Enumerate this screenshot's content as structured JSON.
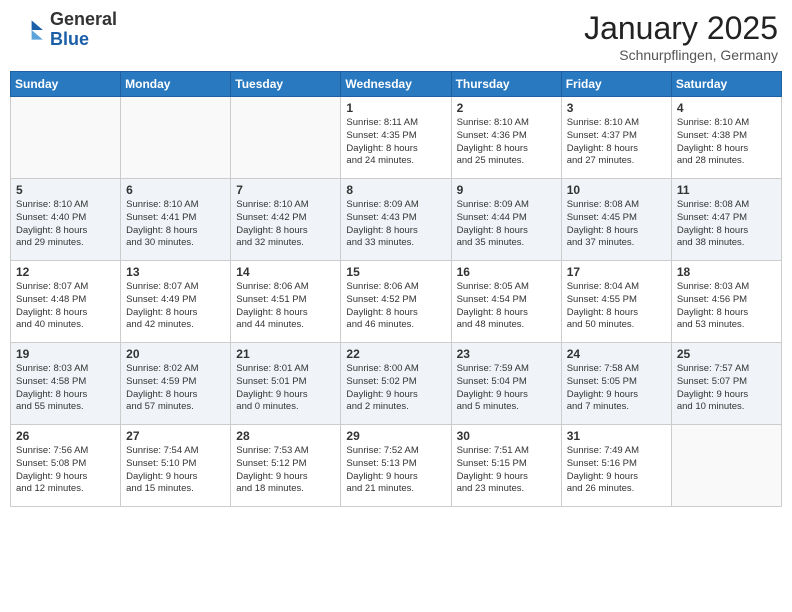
{
  "header": {
    "logo_general": "General",
    "logo_blue": "Blue",
    "month": "January 2025",
    "location": "Schnurpflingen, Germany"
  },
  "weekdays": [
    "Sunday",
    "Monday",
    "Tuesday",
    "Wednesday",
    "Thursday",
    "Friday",
    "Saturday"
  ],
  "weeks": [
    [
      {
        "day": "",
        "content": ""
      },
      {
        "day": "",
        "content": ""
      },
      {
        "day": "",
        "content": ""
      },
      {
        "day": "1",
        "content": "Sunrise: 8:11 AM\nSunset: 4:35 PM\nDaylight: 8 hours\nand 24 minutes."
      },
      {
        "day": "2",
        "content": "Sunrise: 8:10 AM\nSunset: 4:36 PM\nDaylight: 8 hours\nand 25 minutes."
      },
      {
        "day": "3",
        "content": "Sunrise: 8:10 AM\nSunset: 4:37 PM\nDaylight: 8 hours\nand 27 minutes."
      },
      {
        "day": "4",
        "content": "Sunrise: 8:10 AM\nSunset: 4:38 PM\nDaylight: 8 hours\nand 28 minutes."
      }
    ],
    [
      {
        "day": "5",
        "content": "Sunrise: 8:10 AM\nSunset: 4:40 PM\nDaylight: 8 hours\nand 29 minutes."
      },
      {
        "day": "6",
        "content": "Sunrise: 8:10 AM\nSunset: 4:41 PM\nDaylight: 8 hours\nand 30 minutes."
      },
      {
        "day": "7",
        "content": "Sunrise: 8:10 AM\nSunset: 4:42 PM\nDaylight: 8 hours\nand 32 minutes."
      },
      {
        "day": "8",
        "content": "Sunrise: 8:09 AM\nSunset: 4:43 PM\nDaylight: 8 hours\nand 33 minutes."
      },
      {
        "day": "9",
        "content": "Sunrise: 8:09 AM\nSunset: 4:44 PM\nDaylight: 8 hours\nand 35 minutes."
      },
      {
        "day": "10",
        "content": "Sunrise: 8:08 AM\nSunset: 4:45 PM\nDaylight: 8 hours\nand 37 minutes."
      },
      {
        "day": "11",
        "content": "Sunrise: 8:08 AM\nSunset: 4:47 PM\nDaylight: 8 hours\nand 38 minutes."
      }
    ],
    [
      {
        "day": "12",
        "content": "Sunrise: 8:07 AM\nSunset: 4:48 PM\nDaylight: 8 hours\nand 40 minutes."
      },
      {
        "day": "13",
        "content": "Sunrise: 8:07 AM\nSunset: 4:49 PM\nDaylight: 8 hours\nand 42 minutes."
      },
      {
        "day": "14",
        "content": "Sunrise: 8:06 AM\nSunset: 4:51 PM\nDaylight: 8 hours\nand 44 minutes."
      },
      {
        "day": "15",
        "content": "Sunrise: 8:06 AM\nSunset: 4:52 PM\nDaylight: 8 hours\nand 46 minutes."
      },
      {
        "day": "16",
        "content": "Sunrise: 8:05 AM\nSunset: 4:54 PM\nDaylight: 8 hours\nand 48 minutes."
      },
      {
        "day": "17",
        "content": "Sunrise: 8:04 AM\nSunset: 4:55 PM\nDaylight: 8 hours\nand 50 minutes."
      },
      {
        "day": "18",
        "content": "Sunrise: 8:03 AM\nSunset: 4:56 PM\nDaylight: 8 hours\nand 53 minutes."
      }
    ],
    [
      {
        "day": "19",
        "content": "Sunrise: 8:03 AM\nSunset: 4:58 PM\nDaylight: 8 hours\nand 55 minutes."
      },
      {
        "day": "20",
        "content": "Sunrise: 8:02 AM\nSunset: 4:59 PM\nDaylight: 8 hours\nand 57 minutes."
      },
      {
        "day": "21",
        "content": "Sunrise: 8:01 AM\nSunset: 5:01 PM\nDaylight: 9 hours\nand 0 minutes."
      },
      {
        "day": "22",
        "content": "Sunrise: 8:00 AM\nSunset: 5:02 PM\nDaylight: 9 hours\nand 2 minutes."
      },
      {
        "day": "23",
        "content": "Sunrise: 7:59 AM\nSunset: 5:04 PM\nDaylight: 9 hours\nand 5 minutes."
      },
      {
        "day": "24",
        "content": "Sunrise: 7:58 AM\nSunset: 5:05 PM\nDaylight: 9 hours\nand 7 minutes."
      },
      {
        "day": "25",
        "content": "Sunrise: 7:57 AM\nSunset: 5:07 PM\nDaylight: 9 hours\nand 10 minutes."
      }
    ],
    [
      {
        "day": "26",
        "content": "Sunrise: 7:56 AM\nSunset: 5:08 PM\nDaylight: 9 hours\nand 12 minutes."
      },
      {
        "day": "27",
        "content": "Sunrise: 7:54 AM\nSunset: 5:10 PM\nDaylight: 9 hours\nand 15 minutes."
      },
      {
        "day": "28",
        "content": "Sunrise: 7:53 AM\nSunset: 5:12 PM\nDaylight: 9 hours\nand 18 minutes."
      },
      {
        "day": "29",
        "content": "Sunrise: 7:52 AM\nSunset: 5:13 PM\nDaylight: 9 hours\nand 21 minutes."
      },
      {
        "day": "30",
        "content": "Sunrise: 7:51 AM\nSunset: 5:15 PM\nDaylight: 9 hours\nand 23 minutes."
      },
      {
        "day": "31",
        "content": "Sunrise: 7:49 AM\nSunset: 5:16 PM\nDaylight: 9 hours\nand 26 minutes."
      },
      {
        "day": "",
        "content": ""
      }
    ]
  ]
}
